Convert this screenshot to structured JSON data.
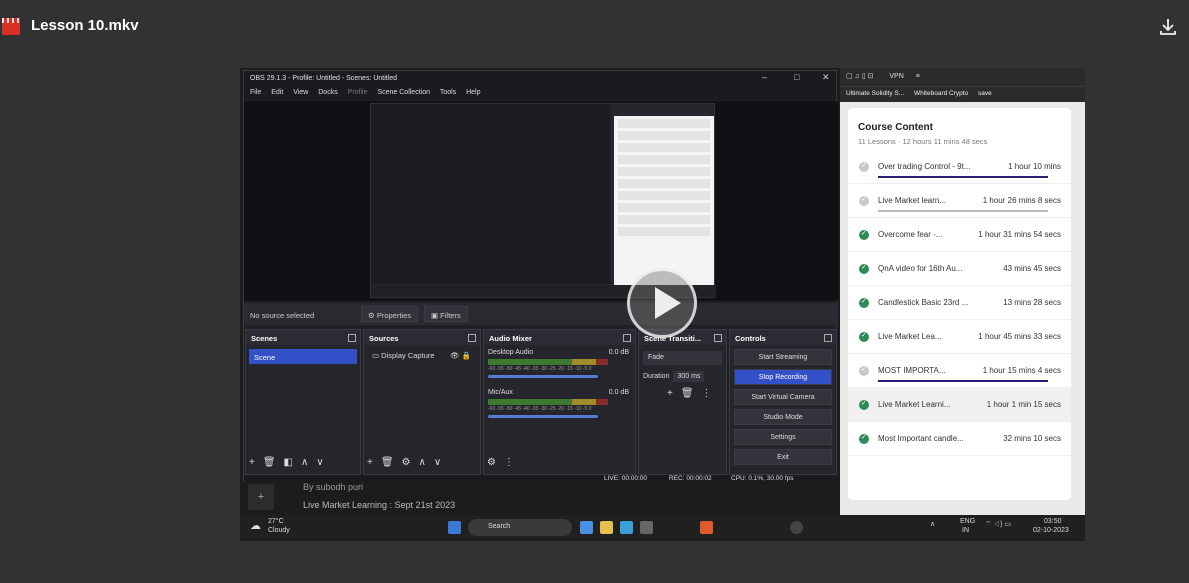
{
  "header": {
    "title": "Lesson 10.mkv",
    "download_icon": "download-icon"
  },
  "obs": {
    "title": "OBS 29.1.3 - Profile: Untitled - Scenes: Untitled",
    "menu": [
      "File",
      "Edit",
      "View",
      "Docks",
      "Profile",
      "Scene Collection",
      "Tools",
      "Help"
    ],
    "no_source": "No source selected",
    "properties": "Properties",
    "filters": "Filters",
    "scenes": {
      "header": "Scenes",
      "item": "Scene"
    },
    "sources": {
      "header": "Sources",
      "item": "Display Capture"
    },
    "mixer": {
      "header": "Audio Mixer",
      "channels": [
        {
          "name": "Desktop Audio",
          "db": "0.0 dB"
        },
        {
          "name": "Mic/Aux",
          "db": "0.0 dB"
        }
      ],
      "scale": "-60 -55 -50 -45 -40 -35 -30 -25 -20 -15 -10 -5 0"
    },
    "transitions": {
      "header": "Scene Transiti...",
      "type": "Fade",
      "duration_label": "Duration",
      "duration": "300 ms"
    },
    "controls": {
      "header": "Controls",
      "buttons": [
        "Start Streaming",
        "Stop Recording",
        "Start Virtual Camera",
        "Studio Mode",
        "Settings",
        "Exit"
      ]
    },
    "status": {
      "live": "LIVE: 00:00:00",
      "rec": "REC: 00:00:02",
      "cpu": "CPU: 0.1%, 30.00 fps"
    }
  },
  "behind": {
    "author": "By subodh puri",
    "line": "Live Market Learning : Sept 21st 2023",
    "plus": "+"
  },
  "browser": {
    "bookmarks": [
      "Ultimate Solidity S...",
      "Whiteboard Crypto",
      "save"
    ],
    "vpn": "VPN",
    "course": {
      "title": "Course Content",
      "subtitle": "11 Lessons  ·  12 hours 11 mins 48 secs",
      "lessons": [
        {
          "name": "Over trading Control - 9t...",
          "duration": "1 hour 10 mins",
          "done": false
        },
        {
          "name": "Live Market learn...",
          "duration": "1 hour 26 mins 8 secs",
          "done": false
        },
        {
          "name": "Overcome fear -...",
          "duration": "1 hour 31 mins 54 secs",
          "done": true
        },
        {
          "name": "QnA video for 16th Au...",
          "duration": "43 mins 45 secs",
          "done": true
        },
        {
          "name": "Candlestick Basic 23rd ...",
          "duration": "13 mins 28 secs",
          "done": true
        },
        {
          "name": "Live Market Lea...",
          "duration": "1 hour 45 mins 33 secs",
          "done": true
        },
        {
          "name": "MOST IMPORTA...",
          "duration": "1 hour 15 mins 4 secs",
          "done": false
        },
        {
          "name": "Live Market Learni...",
          "duration": "1 hour 1 min 15 secs",
          "done": true
        },
        {
          "name": "Most Important candle...",
          "duration": "32 mins 10 secs",
          "done": true
        }
      ]
    }
  },
  "taskbar": {
    "temp": "27°C",
    "weather": "Cloudy",
    "search": "Search",
    "lang": "ENG",
    "region": "IN",
    "time": "03:50",
    "date": "02-10-2023"
  }
}
